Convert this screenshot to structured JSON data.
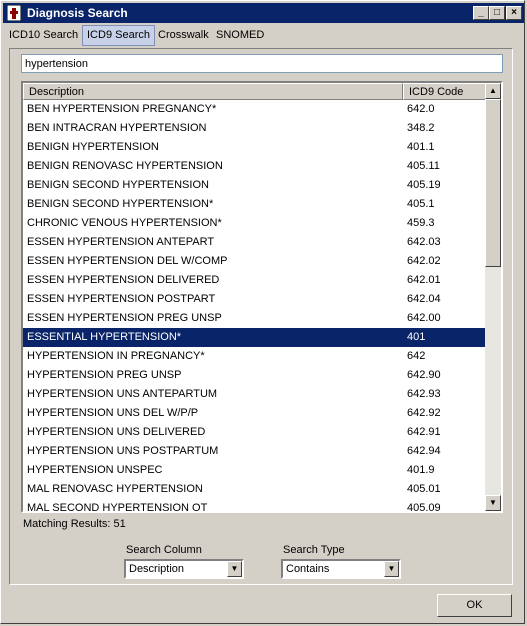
{
  "window": {
    "title": "Diagnosis Search",
    "minimize": "_",
    "maximize": "□",
    "close": "×"
  },
  "tabs": [
    {
      "label": "ICD10 Search"
    },
    {
      "label": "ICD9 Search"
    },
    {
      "label": "Crosswalk"
    },
    {
      "label": "SNOMED"
    }
  ],
  "search": {
    "value": "hypertension"
  },
  "grid": {
    "headers": [
      "Description",
      "ICD9 Code"
    ],
    "rows": [
      {
        "description": "BEN HYPERTENSION PREGNANCY*",
        "code": "642.0"
      },
      {
        "description": "BEN INTRACRAN HYPERTENSION",
        "code": "348.2"
      },
      {
        "description": "BENIGN HYPERTENSION",
        "code": "401.1"
      },
      {
        "description": "BENIGN RENOVASC HYPERTENSION",
        "code": "405.11"
      },
      {
        "description": "BENIGN SECOND HYPERTENSION",
        "code": "405.19"
      },
      {
        "description": "BENIGN SECOND HYPERTENSION*",
        "code": "405.1"
      },
      {
        "description": "CHRONIC VENOUS HYPERTENSION*",
        "code": "459.3"
      },
      {
        "description": "ESSEN HYPERTENSION ANTEPART",
        "code": "642.03"
      },
      {
        "description": "ESSEN HYPERTENSION DEL W/COMP",
        "code": "642.02"
      },
      {
        "description": "ESSEN HYPERTENSION DELIVERED",
        "code": "642.01"
      },
      {
        "description": "ESSEN HYPERTENSION POSTPART",
        "code": "642.04"
      },
      {
        "description": "ESSEN HYPERTENSION PREG UNSP",
        "code": "642.00"
      },
      {
        "description": "ESSENTIAL HYPERTENSION*",
        "code": "401"
      },
      {
        "description": "HYPERTENSION IN PREGNANCY*",
        "code": "642"
      },
      {
        "description": "HYPERTENSION PREG UNSP",
        "code": "642.90"
      },
      {
        "description": "HYPERTENSION UNS ANTEPARTUM",
        "code": "642.93"
      },
      {
        "description": "HYPERTENSION UNS DEL W/P/P",
        "code": "642.92"
      },
      {
        "description": "HYPERTENSION UNS DELIVERED",
        "code": "642.91"
      },
      {
        "description": "HYPERTENSION UNS POSTPARTUM",
        "code": "642.94"
      },
      {
        "description": "HYPERTENSION UNSPEC",
        "code": "401.9"
      },
      {
        "description": "MAL RENOVASC HYPERTENSION",
        "code": "405.01"
      },
      {
        "description": "MAL SECOND HYPERTENSION OT",
        "code": "405.09"
      }
    ],
    "scroll_up": "▲",
    "scroll_down": "▼"
  },
  "matching": "Matching Results: 51",
  "search_column": {
    "label": "Search Column",
    "value": "Description"
  },
  "search_type": {
    "label": "Search Type",
    "value": "Contains"
  },
  "dropdown_arrow": "▼",
  "ok_label": "OK",
  "colors": {
    "titlebar": "#0a246a",
    "selected_row": "#0a246a",
    "window_bg": "#d4d0c8",
    "active_tab": "#c7d1e8"
  }
}
